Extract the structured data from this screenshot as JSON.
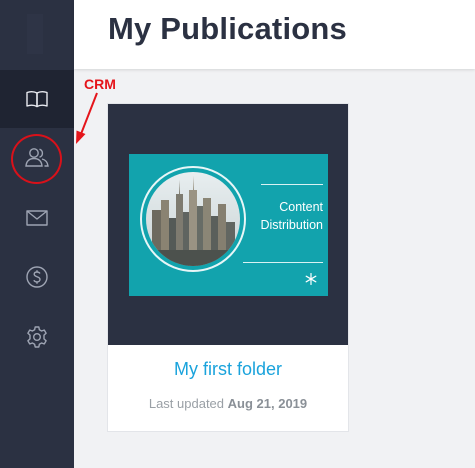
{
  "header": {
    "title": "My Publications"
  },
  "sidebar": {
    "items": [
      {
        "id": "publications",
        "icon": "book-icon",
        "active": true
      },
      {
        "id": "crm",
        "icon": "users-icon",
        "active": false
      },
      {
        "id": "mail",
        "icon": "envelope-icon",
        "active": false
      },
      {
        "id": "billing",
        "icon": "dollar-circle-icon",
        "active": false
      },
      {
        "id": "settings",
        "icon": "gear-icon",
        "active": false
      }
    ]
  },
  "annotation": {
    "label": "CRM",
    "color": "#e5151b"
  },
  "folder": {
    "thumbnail_text": "Content Distribution",
    "name": "My first folder",
    "updated_prefix": "Last updated",
    "updated_date": "Aug 21, 2019"
  },
  "colors": {
    "sidebar": "#2b3142",
    "sidebar_active": "#1f2432",
    "accent_link": "#1aa3dc",
    "thumbnail_bg": "#12a3ad",
    "title": "#2b3142"
  }
}
